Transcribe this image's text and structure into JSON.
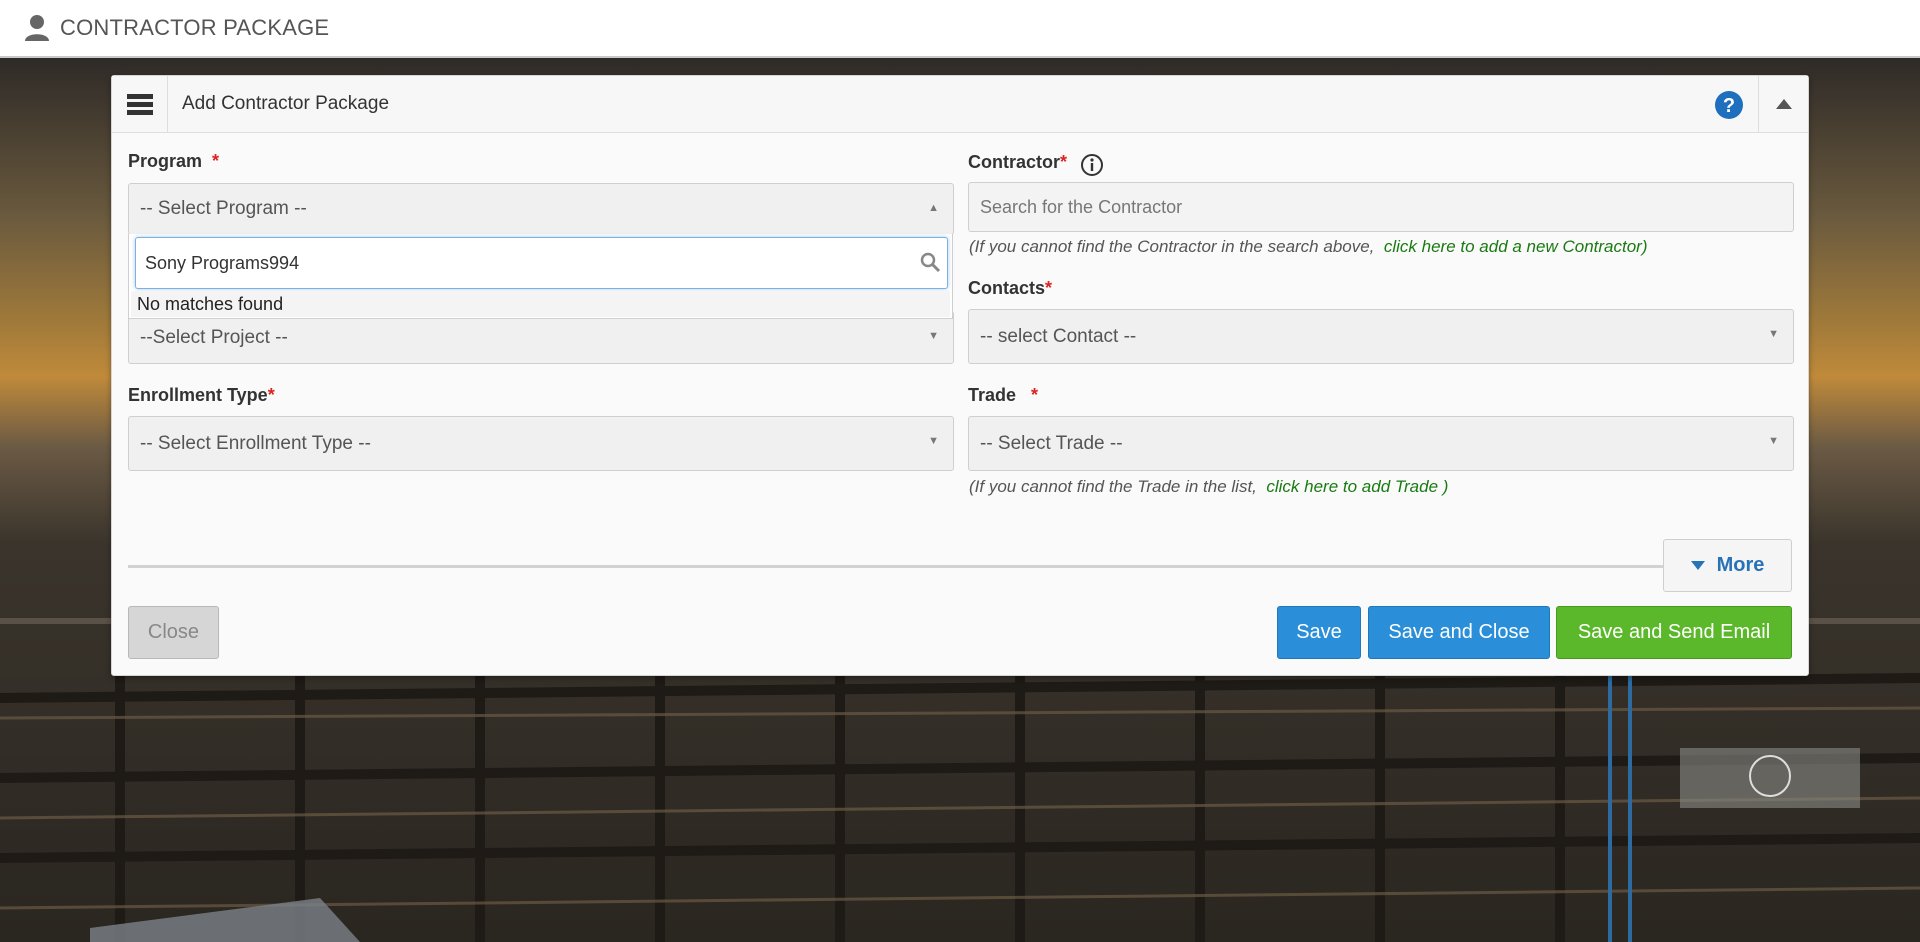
{
  "header": {
    "title": "CONTRACTOR PACKAGE"
  },
  "panel": {
    "title": "Add Contractor Package"
  },
  "form": {
    "program": {
      "label": "Program",
      "required_mark": "*",
      "value": "-- Select Program --"
    },
    "dropdown": {
      "search_value": "Sony Programs994",
      "no_matches": "No matches found"
    },
    "project": {
      "value": "--Select Project --"
    },
    "contractor": {
      "label": "Contractor",
      "required_mark": "*",
      "placeholder": "Search for the Contractor",
      "hint_text": "(If you cannot find the Contractor in the search above,",
      "hint_link": "click here to add a new Contractor)"
    },
    "contacts": {
      "label": "Contacts",
      "required_mark": "*",
      "value": "-- select Contact --"
    },
    "enrollment_type": {
      "label": "Enrollment Type",
      "required_mark": "*",
      "value": "-- Select Enrollment Type --"
    },
    "trade": {
      "label": "Trade",
      "required_mark": "*",
      "value": "-- Select Trade --",
      "hint_text": "(If you cannot find the Trade in the list,",
      "hint_link": "click here to add Trade )"
    }
  },
  "buttons": {
    "more": "More",
    "close": "Close",
    "save": "Save",
    "save_and_close": "Save and Close",
    "save_and_send_email": "Save and Send Email"
  },
  "colors": {
    "primary_blue": "#2a8fd8",
    "success_green": "#5cb82b",
    "link_green": "#1a7a12",
    "required_red": "#d22"
  }
}
